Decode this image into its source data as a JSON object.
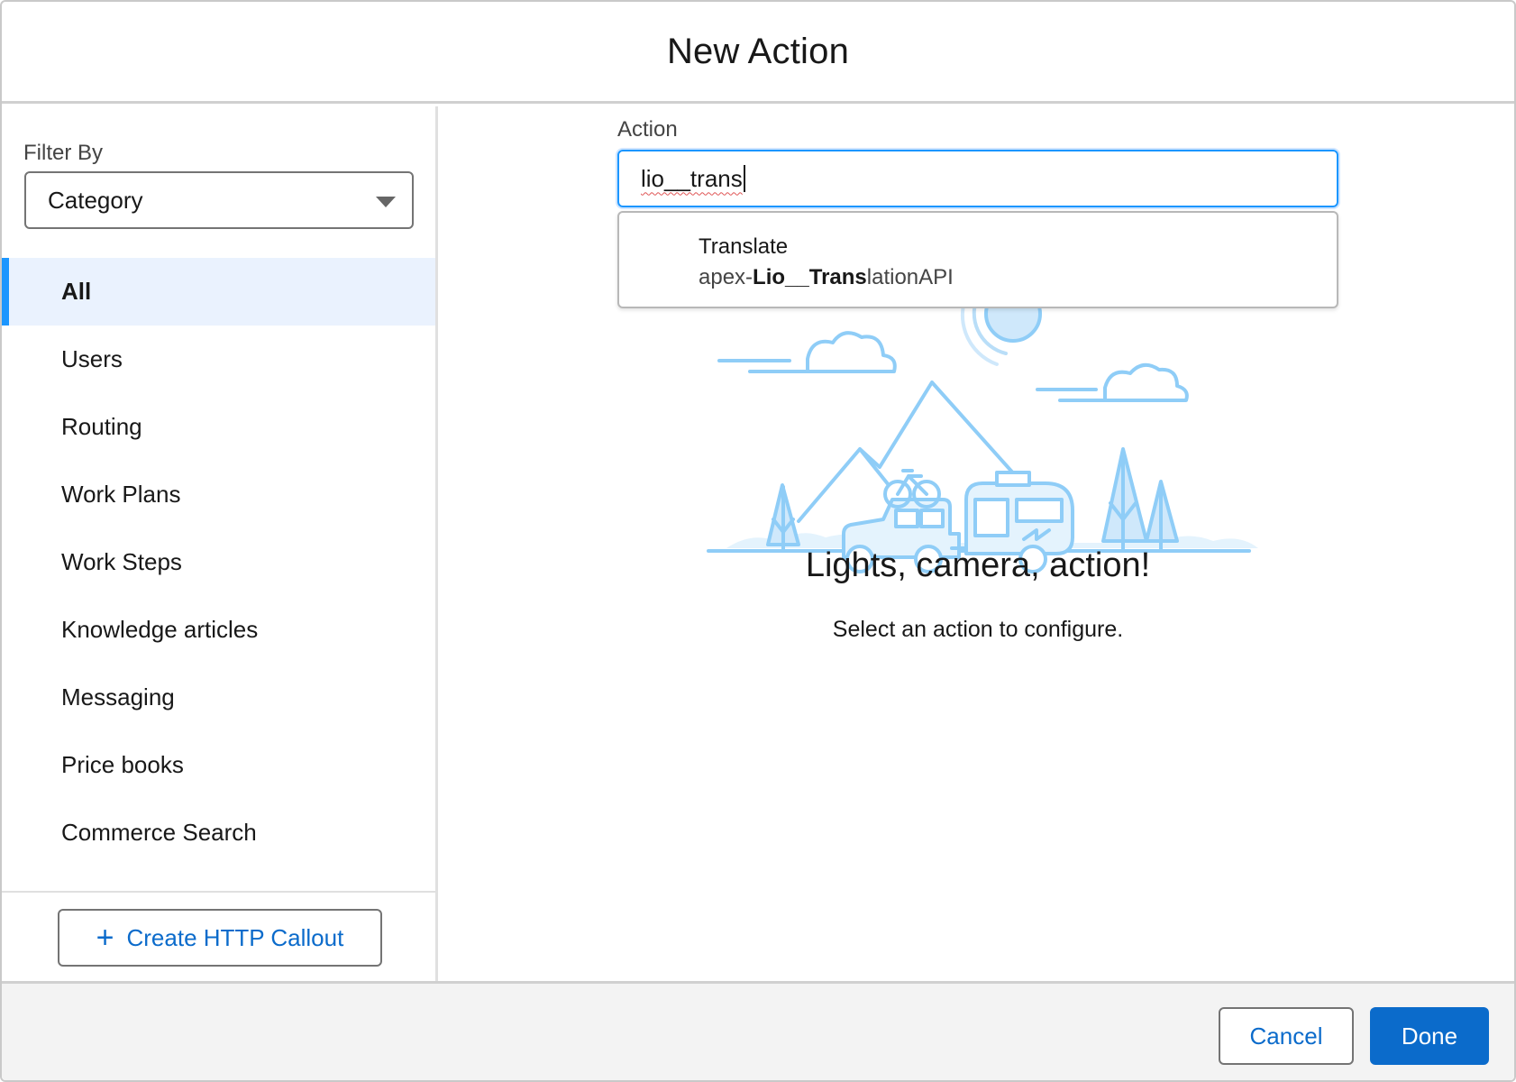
{
  "modal": {
    "title": "New Action"
  },
  "sidebar": {
    "filter_label": "Filter By",
    "filter_value": "Category",
    "items": [
      {
        "label": "All",
        "active": true
      },
      {
        "label": "Users"
      },
      {
        "label": "Routing"
      },
      {
        "label": "Work Plans"
      },
      {
        "label": "Work Steps"
      },
      {
        "label": "Knowledge articles"
      },
      {
        "label": "Messaging"
      },
      {
        "label": "Price books"
      },
      {
        "label": "Commerce Search"
      }
    ],
    "create_button_label": "Create HTTP Callout"
  },
  "action": {
    "label": "Action",
    "input_value": "lio__trans",
    "suggestion": {
      "title": "Translate",
      "sub_prefix": "apex-",
      "sub_match": "Lio__Trans",
      "sub_suffix": "lationAPI"
    }
  },
  "empty_state": {
    "title": "Lights, camera, action!",
    "description": "Select an action to configure."
  },
  "footer": {
    "cancel_label": "Cancel",
    "done_label": "Done"
  },
  "colors": {
    "brand_blue": "#0b6bcb",
    "focus_blue": "#1b96ff",
    "active_bg": "#eaf2fe",
    "illustration_blue": "#8fcdf7"
  }
}
